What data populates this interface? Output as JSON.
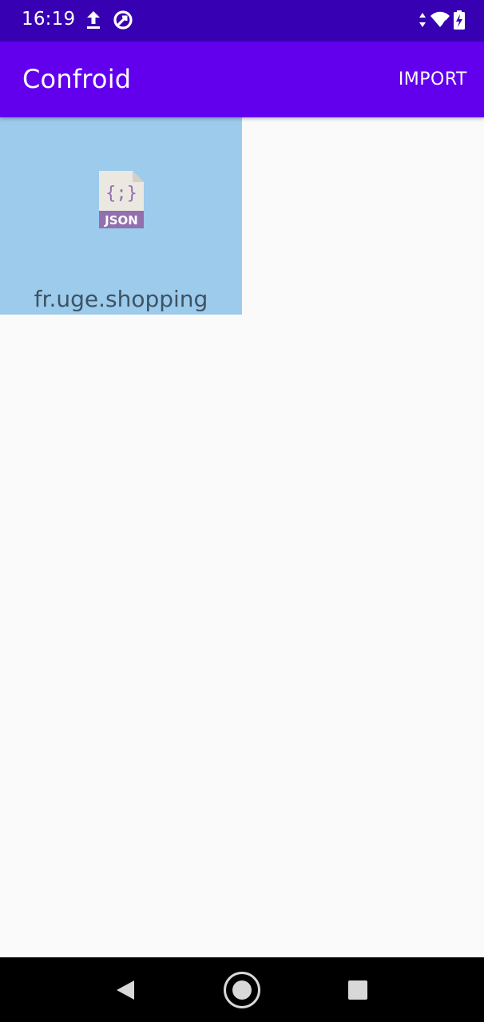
{
  "status_bar": {
    "time": "16:19",
    "icons": [
      "upload-icon",
      "sync-icon",
      "data-arrows-icon",
      "wifi-icon",
      "battery-charging-icon"
    ]
  },
  "app_bar": {
    "title": "Confroid",
    "import_label": "IMPORT"
  },
  "items": [
    {
      "label": "fr.uge.shopping",
      "icon": "json-file-icon",
      "icon_text": "JSON",
      "icon_glyph": "{;}"
    }
  ],
  "navigation": {
    "buttons": [
      "back",
      "home",
      "recents"
    ]
  },
  "colors": {
    "status_bar": "#3700b3",
    "app_bar": "#6200ee",
    "item_background": "#9ccbec",
    "content_background": "#fafafa",
    "json_badge": "#9170ad"
  }
}
